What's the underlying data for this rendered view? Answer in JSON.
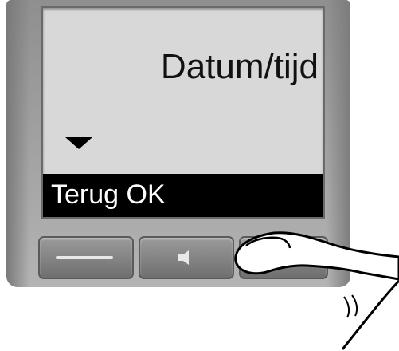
{
  "display": {
    "title": "Datum/tijd",
    "softkeys": "Terug OK"
  },
  "icons": {
    "scroll": "scroll-down-arrow-icon",
    "left_key": "dash-icon",
    "middle_key": "speaker-icon",
    "hand": "finger-icon"
  },
  "colors": {
    "screen_background": "#d8d8d8",
    "softkey_bar": "#000000",
    "softkey_text": "#ffffff",
    "housing": "#a3a3a3"
  }
}
